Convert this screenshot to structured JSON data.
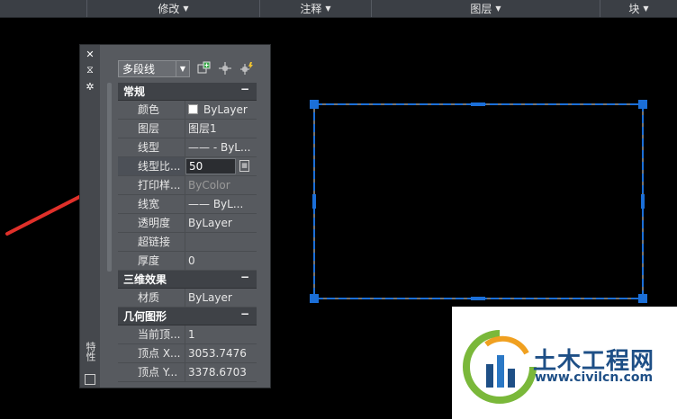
{
  "ribbon": {
    "panels": [
      {
        "label": ""
      },
      {
        "label": "修改"
      },
      {
        "label": "注释"
      },
      {
        "label": "图层"
      },
      {
        "label": "块"
      }
    ]
  },
  "palette": {
    "title": "特性",
    "object_type": "多段线",
    "sections": {
      "general": {
        "title": "常规",
        "collapse": "−",
        "rows": [
          {
            "key": "颜色",
            "value": "ByLayer"
          },
          {
            "key": "图层",
            "value": "图层1"
          },
          {
            "key": "线型",
            "value": "—— - ByL..."
          },
          {
            "key": "线型比...",
            "value": "50"
          },
          {
            "key": "打印样...",
            "value": "ByColor"
          },
          {
            "key": "线宽",
            "value": "—— ByL..."
          },
          {
            "key": "透明度",
            "value": "ByLayer"
          },
          {
            "key": "超链接",
            "value": ""
          },
          {
            "key": "厚度",
            "value": "0"
          }
        ]
      },
      "three_d": {
        "title": "三维效果",
        "collapse": "−",
        "rows": [
          {
            "key": "材质",
            "value": "ByLayer"
          }
        ]
      },
      "geometry": {
        "title": "几何图形",
        "collapse": "−",
        "rows": [
          {
            "key": "当前顶...",
            "value": "1"
          },
          {
            "key": "顶点 X...",
            "value": "3053.7476"
          },
          {
            "key": "顶点 Y...",
            "value": "3378.6703"
          }
        ]
      }
    }
  },
  "watermark": {
    "brand": "土木工程网",
    "url": "www.civilcn.com"
  },
  "colors": {
    "selection": "#1b6fd8",
    "arrow": "#e0302a",
    "brand": "#1e4f86"
  }
}
